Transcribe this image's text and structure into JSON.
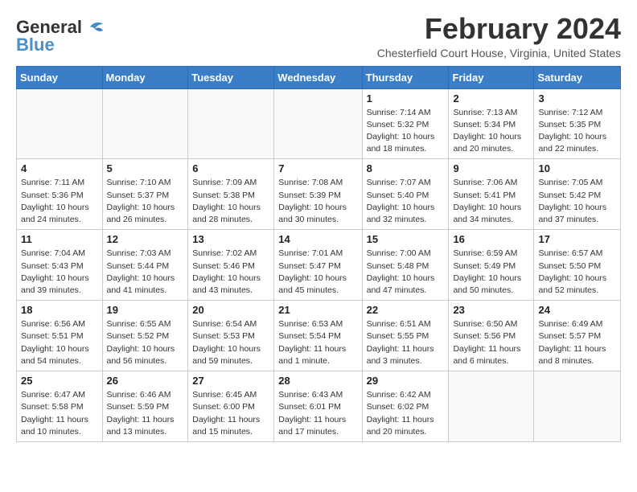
{
  "header": {
    "logo_line1": "General",
    "logo_line2": "Blue",
    "month_title": "February 2024",
    "subtitle": "Chesterfield Court House, Virginia, United States"
  },
  "days_of_week": [
    "Sunday",
    "Monday",
    "Tuesday",
    "Wednesday",
    "Thursday",
    "Friday",
    "Saturday"
  ],
  "weeks": [
    [
      {
        "day": "",
        "info": ""
      },
      {
        "day": "",
        "info": ""
      },
      {
        "day": "",
        "info": ""
      },
      {
        "day": "",
        "info": ""
      },
      {
        "day": "1",
        "info": "Sunrise: 7:14 AM\nSunset: 5:32 PM\nDaylight: 10 hours\nand 18 minutes."
      },
      {
        "day": "2",
        "info": "Sunrise: 7:13 AM\nSunset: 5:34 PM\nDaylight: 10 hours\nand 20 minutes."
      },
      {
        "day": "3",
        "info": "Sunrise: 7:12 AM\nSunset: 5:35 PM\nDaylight: 10 hours\nand 22 minutes."
      }
    ],
    [
      {
        "day": "4",
        "info": "Sunrise: 7:11 AM\nSunset: 5:36 PM\nDaylight: 10 hours\nand 24 minutes."
      },
      {
        "day": "5",
        "info": "Sunrise: 7:10 AM\nSunset: 5:37 PM\nDaylight: 10 hours\nand 26 minutes."
      },
      {
        "day": "6",
        "info": "Sunrise: 7:09 AM\nSunset: 5:38 PM\nDaylight: 10 hours\nand 28 minutes."
      },
      {
        "day": "7",
        "info": "Sunrise: 7:08 AM\nSunset: 5:39 PM\nDaylight: 10 hours\nand 30 minutes."
      },
      {
        "day": "8",
        "info": "Sunrise: 7:07 AM\nSunset: 5:40 PM\nDaylight: 10 hours\nand 32 minutes."
      },
      {
        "day": "9",
        "info": "Sunrise: 7:06 AM\nSunset: 5:41 PM\nDaylight: 10 hours\nand 34 minutes."
      },
      {
        "day": "10",
        "info": "Sunrise: 7:05 AM\nSunset: 5:42 PM\nDaylight: 10 hours\nand 37 minutes."
      }
    ],
    [
      {
        "day": "11",
        "info": "Sunrise: 7:04 AM\nSunset: 5:43 PM\nDaylight: 10 hours\nand 39 minutes."
      },
      {
        "day": "12",
        "info": "Sunrise: 7:03 AM\nSunset: 5:44 PM\nDaylight: 10 hours\nand 41 minutes."
      },
      {
        "day": "13",
        "info": "Sunrise: 7:02 AM\nSunset: 5:46 PM\nDaylight: 10 hours\nand 43 minutes."
      },
      {
        "day": "14",
        "info": "Sunrise: 7:01 AM\nSunset: 5:47 PM\nDaylight: 10 hours\nand 45 minutes."
      },
      {
        "day": "15",
        "info": "Sunrise: 7:00 AM\nSunset: 5:48 PM\nDaylight: 10 hours\nand 47 minutes."
      },
      {
        "day": "16",
        "info": "Sunrise: 6:59 AM\nSunset: 5:49 PM\nDaylight: 10 hours\nand 50 minutes."
      },
      {
        "day": "17",
        "info": "Sunrise: 6:57 AM\nSunset: 5:50 PM\nDaylight: 10 hours\nand 52 minutes."
      }
    ],
    [
      {
        "day": "18",
        "info": "Sunrise: 6:56 AM\nSunset: 5:51 PM\nDaylight: 10 hours\nand 54 minutes."
      },
      {
        "day": "19",
        "info": "Sunrise: 6:55 AM\nSunset: 5:52 PM\nDaylight: 10 hours\nand 56 minutes."
      },
      {
        "day": "20",
        "info": "Sunrise: 6:54 AM\nSunset: 5:53 PM\nDaylight: 10 hours\nand 59 minutes."
      },
      {
        "day": "21",
        "info": "Sunrise: 6:53 AM\nSunset: 5:54 PM\nDaylight: 11 hours\nand 1 minute."
      },
      {
        "day": "22",
        "info": "Sunrise: 6:51 AM\nSunset: 5:55 PM\nDaylight: 11 hours\nand 3 minutes."
      },
      {
        "day": "23",
        "info": "Sunrise: 6:50 AM\nSunset: 5:56 PM\nDaylight: 11 hours\nand 6 minutes."
      },
      {
        "day": "24",
        "info": "Sunrise: 6:49 AM\nSunset: 5:57 PM\nDaylight: 11 hours\nand 8 minutes."
      }
    ],
    [
      {
        "day": "25",
        "info": "Sunrise: 6:47 AM\nSunset: 5:58 PM\nDaylight: 11 hours\nand 10 minutes."
      },
      {
        "day": "26",
        "info": "Sunrise: 6:46 AM\nSunset: 5:59 PM\nDaylight: 11 hours\nand 13 minutes."
      },
      {
        "day": "27",
        "info": "Sunrise: 6:45 AM\nSunset: 6:00 PM\nDaylight: 11 hours\nand 15 minutes."
      },
      {
        "day": "28",
        "info": "Sunrise: 6:43 AM\nSunset: 6:01 PM\nDaylight: 11 hours\nand 17 minutes."
      },
      {
        "day": "29",
        "info": "Sunrise: 6:42 AM\nSunset: 6:02 PM\nDaylight: 11 hours\nand 20 minutes."
      },
      {
        "day": "",
        "info": ""
      },
      {
        "day": "",
        "info": ""
      }
    ]
  ]
}
